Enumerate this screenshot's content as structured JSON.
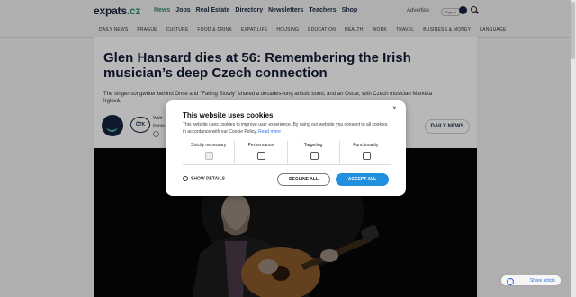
{
  "header": {
    "logo_main": "expats",
    "logo_tld": ".cz",
    "nav": [
      "News",
      "Jobs",
      "Real Estate",
      "Directory",
      "Newsletters",
      "Teachers",
      "Shop"
    ],
    "advertise": "Advertise",
    "signin": "Sign in"
  },
  "subnav": [
    "DAILY NEWS",
    "PRAGUE",
    "CULTURE",
    "FOOD & DRINK",
    "EXPAT LIFE",
    "HOUSING",
    "EDUCATION",
    "HEALTH",
    "WORK",
    "TRAVEL",
    "BUSINESS & MONEY",
    "LANGUAGE"
  ],
  "article": {
    "title": "Glen Hansard dies at 56: Remembering the Irish musician’s deep Czech connection",
    "lede": "The singer-songwriter behind Once and \"Falling Slowly\" shared a decades-long artistic bond, and an Oscar, with Czech musician Markéta Irglová.",
    "writer_label": "Writt",
    "publisher_label": "Publis",
    "ctk": "ČTK",
    "category_badge": "DAILY NEWS"
  },
  "cookie": {
    "title": "This website uses cookies",
    "text": "This website uses cookies to improve user experience. By using our website you consent to all cookies in accordance with our Cookie Policy.",
    "read_more": "Read more",
    "categories": [
      "Strictly necessary",
      "Performance",
      "Targeting",
      "Functionality"
    ],
    "show_details": "SHOW DETAILS",
    "decline": "DECLINE ALL",
    "accept": "ACCEPT ALL",
    "close": "×"
  },
  "share": {
    "label": "Share article"
  },
  "colors": {
    "accent": "#2a8a6e",
    "accept": "#1f8fde",
    "navy": "#16223d"
  }
}
